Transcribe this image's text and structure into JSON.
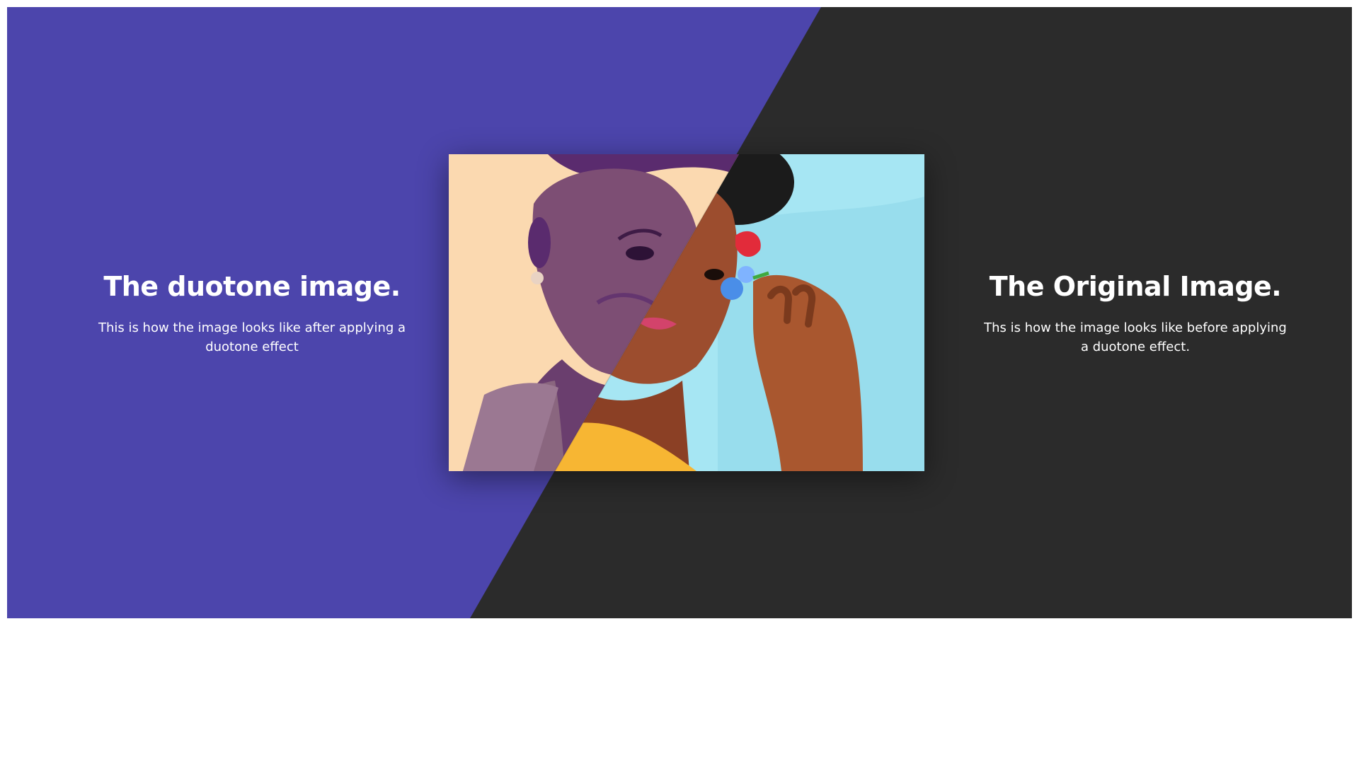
{
  "left_panel": {
    "title": "The duotone image.",
    "description": "This is how the image looks like after applying a duotone effect"
  },
  "right_panel": {
    "title": "The Original Image.",
    "description": "Ths is how the image looks like before applying a duotone effect."
  },
  "colors": {
    "left_background": "#4c45ac",
    "right_background": "#2b2b2b",
    "text": "#ffffff",
    "duotone_highlight": "#fbd9b0",
    "duotone_shadow": "#5a2b6e",
    "original_backdrop": "#a6e6f3",
    "original_shirt": "#f7b633",
    "original_skin": "#9c4d2e"
  },
  "image": {
    "subject": "portrait of a woman holding flowers",
    "icon": "photo-comparison"
  }
}
